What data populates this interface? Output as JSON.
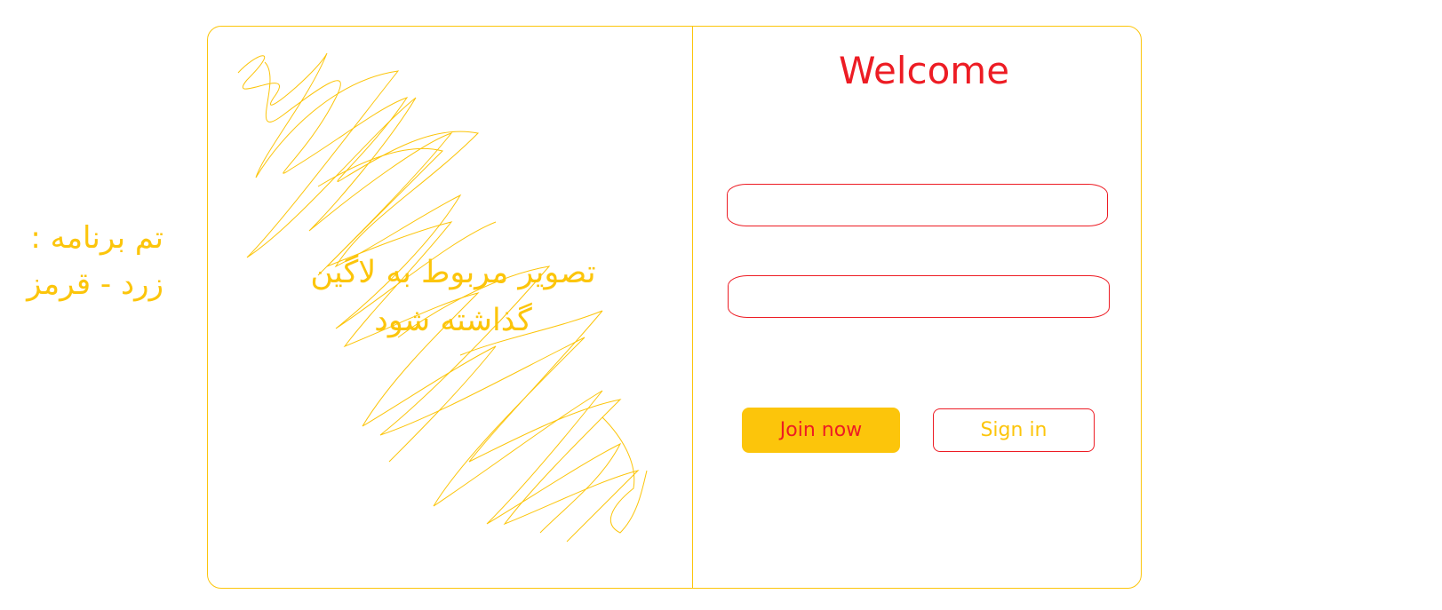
{
  "theme_note": {
    "line1": "تم برنامه :",
    "line2": "زرد - قرمز"
  },
  "image_placeholder": {
    "line1": "تصویر مربوط به لاگین",
    "line2": "گذاشته شود"
  },
  "login": {
    "title": "Welcome",
    "field_1": {
      "value": "",
      "placeholder": ""
    },
    "field_2": {
      "value": "",
      "placeholder": ""
    },
    "join_label": "Join now",
    "sign_in_label": "Sign in"
  },
  "colors": {
    "yellow": "#fcc50b",
    "red": "#ed1c24"
  }
}
